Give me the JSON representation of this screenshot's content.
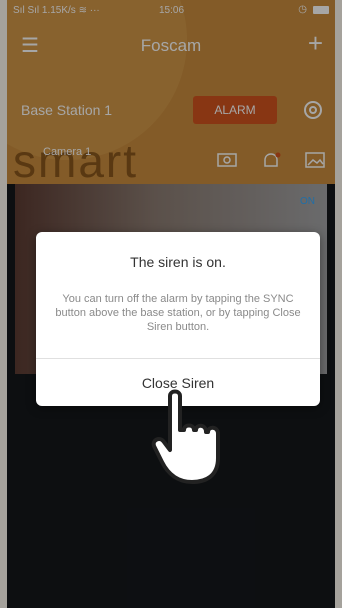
{
  "status_bar": {
    "left": "Sıl Sıl 1.15K/s ≋ ···",
    "time": "15:06"
  },
  "header": {
    "title": "Foscam",
    "menu_icon": "menu-icon",
    "plus_icon": "plus-icon"
  },
  "station": {
    "name": "Base Station 1",
    "alarm_label": "ALARM"
  },
  "camera": {
    "name": "Camera 1",
    "watermark": "smart",
    "on_label": "ON"
  },
  "dialog": {
    "title": "The siren is on.",
    "message": "You can turn off the alarm by tapping the SYNC button above the base station, or by tapping Close Siren button.",
    "button": "Close Siren"
  },
  "colors": {
    "header_bg": "#c98d3e",
    "alarm": "#d2541e",
    "dialog_bg": "#ffffff"
  }
}
